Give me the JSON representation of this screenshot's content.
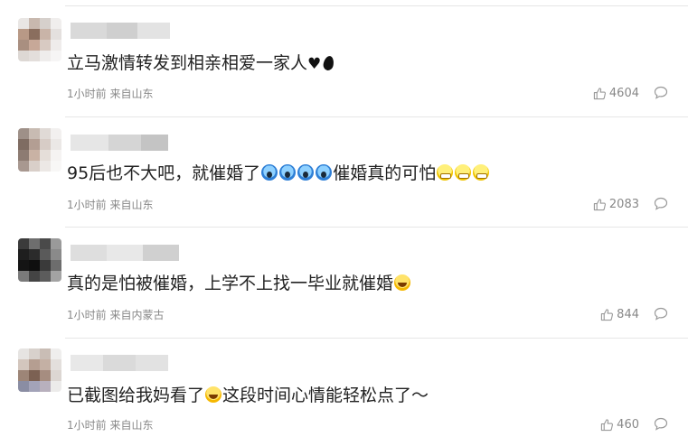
{
  "comments": [
    {
      "text": "立马激情转发到相亲相爱一家人",
      "meta": "1小时前 来自山东",
      "likes": "4604",
      "avatar_colors": [
        "#e9e6e4",
        "#c8b8ae",
        "#d6d0cc",
        "#f0eeed",
        "#b89986",
        "#8a6e5e",
        "#c9b4a8",
        "#e4e0de",
        "#a98f80",
        "#c7a898",
        "#d8cac2",
        "#efeceb",
        "#ddd8d4",
        "#e3dedb",
        "#efedec",
        "#f6f5f5"
      ]
    },
    {
      "text": "95后也不大吧，就催婚了",
      "text2": "催婚真的可怕",
      "meta": "1小时前 来自山东",
      "likes": "2083",
      "avatar_colors": [
        "#9e9088",
        "#c8bbb2",
        "#e0dad6",
        "#f2f0ef",
        "#7f6c62",
        "#b39e93",
        "#d7ccc6",
        "#ebe8e6",
        "#8d7b72",
        "#c9b2a4",
        "#e5ded9",
        "#f5f3f2",
        "#a89890",
        "#d9cfc9",
        "#ece8e5",
        "#f8f7f6"
      ]
    },
    {
      "text": "真的是怕被催婚，上学不上找一毕业就催婚",
      "meta": "1小时前 来自内蒙古",
      "likes": "844",
      "avatar_colors": [
        "#3b3b3b",
        "#6e6e6e",
        "#4a4a4a",
        "#9a9a9a",
        "#1e1e1e",
        "#2b2b2b",
        "#5a5a5a",
        "#8a8a8a",
        "#141414",
        "#0f0f0f",
        "#3a3a3a",
        "#6d6d6d",
        "#7a7a7a",
        "#444444",
        "#5c5c5c",
        "#a3a3a3"
      ]
    },
    {
      "text": "已截图给我妈看了",
      "text2": "这段时间心情能轻松点了～",
      "meta": "1小时前 来自山东",
      "likes": "460",
      "avatar_colors": [
        "#e6e4e2",
        "#d8d1cc",
        "#c9bdb5",
        "#efeeed",
        "#d3c6bd",
        "#b59e91",
        "#c4b0a4",
        "#e3dfdc",
        "#9d8577",
        "#7c6153",
        "#a68d80",
        "#dcd6d2",
        "#8a8da3",
        "#a3a3b8",
        "#b8b0bd",
        "#ecebea"
      ]
    }
  ]
}
